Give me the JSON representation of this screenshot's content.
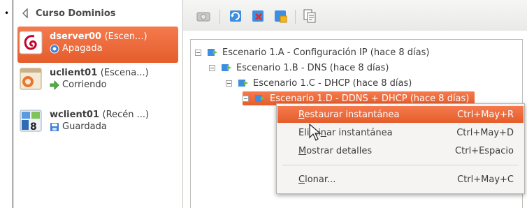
{
  "bullet": "•",
  "sidebar": {
    "group": {
      "label": "Curso Dominios"
    },
    "vms": [
      {
        "name": "dserver00",
        "snapshot": "(Escen...)",
        "state": "Apagada",
        "selected": true
      },
      {
        "name": "uclient01",
        "snapshot": "(Escena...)",
        "state": "Corriendo",
        "selected": false
      },
      {
        "name": "wclient01",
        "snapshot": "(Recén ...)",
        "state": "Guardada",
        "selected": false
      }
    ]
  },
  "toolbar": {
    "buttons": [
      "take-snapshot",
      "restore-snapshot",
      "delete-snapshot",
      "snapshot-details",
      "clone"
    ]
  },
  "tree": {
    "nodes": [
      {
        "label": "Escenario 1.A - Configuración IP (hace 8 días)"
      },
      {
        "label": "Escenario 1.B - DNS (hace 8 días)"
      },
      {
        "label": "Escenario 1.C - DHCP (hace 8 días)"
      },
      {
        "label": "Escenario 1.D - DDNS + DHCP (hace 8 días)",
        "selected": true
      }
    ]
  },
  "menu": {
    "items": [
      {
        "pre": "",
        "mn": "R",
        "post": "estaurar instantánea",
        "shortcut": "Ctrl+May+R",
        "highlighted": true
      },
      {
        "pre": "Elimi",
        "mn": "n",
        "post": "ar instantánea",
        "shortcut": "Ctrl+May+D",
        "highlighted": false
      },
      {
        "pre": "",
        "mn": "M",
        "post": "ostrar detalles",
        "shortcut": "Ctrl+Espacio",
        "highlighted": false
      },
      {
        "pre": "",
        "mn": "C",
        "post": "lonar...",
        "shortcut": "Ctrl+May+C",
        "highlighted": false
      }
    ]
  },
  "colors": {
    "accent": "#e8632f",
    "accent_light": "#f57a4e"
  }
}
